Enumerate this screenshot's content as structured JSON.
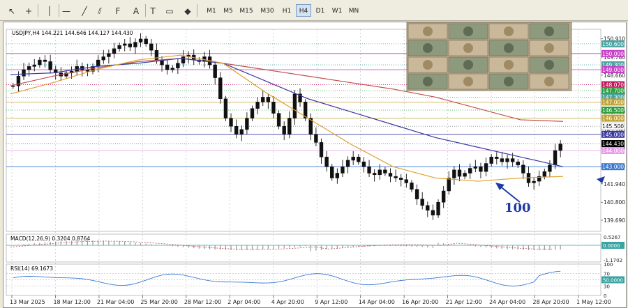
{
  "toolbar": {
    "icons": [
      "cursor-icon",
      "crosshair-icon",
      "vertical-line-icon",
      "horizontal-line-icon",
      "trendline-icon",
      "channel-icon",
      "fibonacci-icon",
      "text-icon",
      "text-label-icon",
      "rectangle-icon",
      "shapes-menu-icon"
    ],
    "timeframes": [
      "M1",
      "M5",
      "M15",
      "M30",
      "H1",
      "H4",
      "D1",
      "W1",
      "MN"
    ],
    "active_timeframe": "H4",
    "text_glyph": "A",
    "label_glyph": "T"
  },
  "chart_data": {
    "type": "candlestick",
    "symbol_header": "USDJPY,H4  144.221 144.646 144.127 144.430",
    "price_axis": {
      "ylim": [
        139.0,
        151.5
      ],
      "ticks": [
        "150.910",
        "149.780",
        "148.660",
        "147.530",
        "146.400",
        "145.280",
        "144.150",
        "143.030",
        "141.940",
        "140.800",
        "139.690"
      ]
    },
    "time_labels": [
      "13 Mar 2025",
      "18 Mar 12:00",
      "21 Mar 04:00",
      "25 Mar 20:00",
      "28 Mar 12:00",
      "2 Apr 04:00",
      "4 Apr 20:00",
      "9 Apr 12:00",
      "14 Apr 04:00",
      "16 Apr 20:00",
      "21 Apr 12:00",
      "24 Apr 04:00",
      "28 Apr 20:00",
      "1 May 12:00"
    ],
    "closes": [
      148.0,
      148.6,
      149.0,
      149.2,
      149.3,
      149.6,
      149.5,
      149.0,
      148.8,
      148.6,
      148.8,
      148.9,
      149.2,
      149.0,
      148.9,
      149.2,
      149.6,
      149.8,
      150.0,
      150.3,
      150.5,
      150.6,
      150.4,
      150.7,
      150.9,
      150.6,
      150.2,
      149.6,
      149.3,
      149.0,
      149.1,
      149.4,
      149.8,
      149.9,
      149.6,
      149.5,
      149.8,
      149.3,
      148.5,
      147.2,
      146.0,
      145.5,
      145.0,
      145.3,
      146.0,
      146.6,
      147.0,
      147.3,
      147.0,
      146.3,
      145.5,
      145.0,
      146.0,
      147.5,
      147.0,
      146.0,
      145.0,
      144.5,
      143.6,
      143.0,
      142.3,
      142.6,
      143.0,
      143.4,
      143.6,
      143.3,
      143.0,
      142.6,
      142.5,
      142.8,
      142.6,
      142.4,
      142.3,
      142.2,
      142.0,
      141.6,
      141.0,
      140.6,
      140.3,
      140.0,
      140.8,
      141.5,
      142.3,
      142.8,
      142.4,
      142.6,
      142.9,
      143.0,
      142.7,
      143.2,
      143.6,
      143.5,
      143.3,
      143.5,
      143.3,
      143.1,
      142.6,
      142.0,
      142.1,
      142.4,
      142.7,
      143.1,
      144.0,
      144.4
    ],
    "moving_averages": [
      {
        "color": "#c0504d",
        "values": [
          148.0,
          148.6,
          149.1,
          149.5,
          149.7,
          149.4,
          149.0,
          148.6,
          148.2,
          147.8,
          147.3,
          146.6,
          145.9,
          145.8
        ]
      },
      {
        "color": "#3a3aa0",
        "values": [
          148.7,
          148.8,
          149.2,
          149.4,
          149.7,
          149.4,
          148.3,
          147.2,
          146.4,
          145.6,
          144.8,
          144.2,
          143.6,
          143.0
        ]
      },
      {
        "color": "#e0a030",
        "values": [
          147.5,
          148.2,
          149.0,
          149.6,
          149.9,
          149.4,
          147.6,
          146.0,
          144.4,
          143.0,
          142.3,
          142.1,
          142.3,
          142.4
        ]
      }
    ],
    "horizontal_levels": [
      {
        "price": 150.6,
        "label": "150.600",
        "color": "#4aa3a3",
        "line_color": "#4aa3a3",
        "style": "dotted"
      },
      {
        "price": 150.0,
        "label": "150.000",
        "color": "#c83fc8",
        "line_color": "#c83fc8",
        "style": "solid"
      },
      {
        "price": 149.3,
        "label": "149.300",
        "color": "#4aa3a3",
        "line_color": "#4aa3a3",
        "style": "dotted"
      },
      {
        "price": 149.0,
        "label": "149.000",
        "color": "#c83fc8",
        "line_color": "#c83fc8",
        "style": "solid"
      },
      {
        "price": 148.07,
        "label": "148.070",
        "color": "#c0175b",
        "line_color": "#c0175b",
        "style": "dotted"
      },
      {
        "price": 147.7,
        "label": "147.700",
        "color": "#2e9e3e",
        "line_color": "#2e9e3e",
        "style": "dotted"
      },
      {
        "price": 147.3,
        "label": "147.300",
        "color": "#4aa3a3",
        "line_color": "#4aa3a3",
        "style": "dotted"
      },
      {
        "price": 147.0,
        "label": "147.000",
        "color": "#c0a032",
        "line_color": "#c0a032",
        "style": "solid"
      },
      {
        "price": 146.5,
        "label": "146.500",
        "color": "#2e9e3e",
        "line_color": "#2e9e3e",
        "style": "dotted"
      },
      {
        "price": 146.0,
        "label": "146.000",
        "color": "#c0a032",
        "line_color": "#c0a032",
        "style": "solid"
      },
      {
        "price": 145.5,
        "label": "145.500",
        "color": "#ffffff",
        "line_color": "#888888",
        "style": "dotted",
        "text_color": "#000000"
      },
      {
        "price": 145.0,
        "label": "145.000",
        "color": "#3a3aa0",
        "line_color": "#3a3aa0",
        "style": "solid"
      },
      {
        "price": 144.43,
        "label": "144.430",
        "color": "#000000",
        "line_color": "#666666",
        "style": "dotted"
      },
      {
        "price": 144.0,
        "label": "144.000",
        "color": "#e89be8",
        "line_color": "#e89be8",
        "style": "solid"
      },
      {
        "price": 143.0,
        "label": "143.000",
        "color": "#3a79d0",
        "line_color": "#3a79d0",
        "style": "solid"
      }
    ],
    "annotation": "100",
    "macd": {
      "label": "MACD(12,26,9) 0.3204 0.8764",
      "ticks": [
        "0.5267",
        "0.0000",
        "-1.1702"
      ]
    },
    "rsi": {
      "label": "RSI(14) 69.1673",
      "ticks": [
        "100",
        "70",
        "50.0000",
        "30",
        "0"
      ]
    }
  }
}
